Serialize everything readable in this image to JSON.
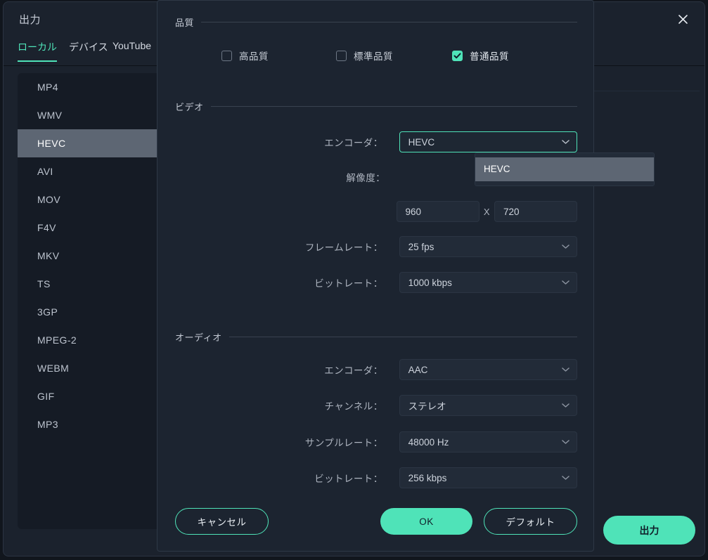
{
  "export_window": {
    "title": "出力",
    "close_icon": "close-icon",
    "tabs": [
      {
        "label": "ローカル",
        "active": true
      },
      {
        "label": "デバイス",
        "active": false
      },
      {
        "label": "YouTube",
        "active": false
      }
    ],
    "formats": [
      {
        "label": "MP4",
        "selected": false
      },
      {
        "label": "WMV",
        "selected": false
      },
      {
        "label": "HEVC",
        "selected": true
      },
      {
        "label": "AVI",
        "selected": false
      },
      {
        "label": "MOV",
        "selected": false
      },
      {
        "label": "F4V",
        "selected": false
      },
      {
        "label": "MKV",
        "selected": false
      },
      {
        "label": "TS",
        "selected": false
      },
      {
        "label": "3GP",
        "selected": false
      },
      {
        "label": "MPEG-2",
        "selected": false
      },
      {
        "label": "WEBM",
        "selected": false
      },
      {
        "label": "GIF",
        "selected": false
      },
      {
        "label": "MP3",
        "selected": false
      }
    ],
    "export_button": "出力"
  },
  "dialog": {
    "quality": {
      "section_title": "品質",
      "options": [
        {
          "label": "高品質",
          "checked": false
        },
        {
          "label": "標準品質",
          "checked": false
        },
        {
          "label": "普通品質",
          "checked": true
        }
      ]
    },
    "video": {
      "section_title": "ビデオ",
      "encoder_label": "エンコーダ：",
      "encoder_value": "HEVC",
      "encoder_open": true,
      "encoder_options": [
        "HEVC"
      ],
      "resolution_label": "解像度：",
      "resolution_width": "960",
      "resolution_separator": "X",
      "resolution_height": "720",
      "framerate_label": "フレームレート：",
      "framerate_value": "25 fps",
      "bitrate_label": "ビットレート：",
      "bitrate_value": "1000 kbps"
    },
    "audio": {
      "section_title": "オーディオ",
      "encoder_label": "エンコーダ：",
      "encoder_value": "AAC",
      "channel_label": "チャンネル：",
      "channel_value": "ステレオ",
      "samplerate_label": "サンプルレート：",
      "samplerate_value": "48000 Hz",
      "bitrate_label": "ビットレート：",
      "bitrate_value": "256 kbps"
    },
    "footer": {
      "cancel": "キャンセル",
      "ok": "OK",
      "default": "デフォルト"
    }
  },
  "colors": {
    "accent": "#4fe3b8",
    "panel": "#1c2430",
    "window": "#1b222d",
    "highlight": "#5d6673"
  }
}
